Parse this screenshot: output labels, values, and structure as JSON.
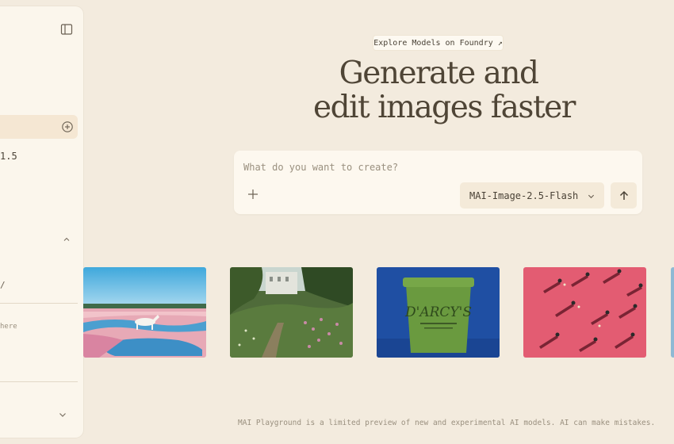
{
  "sidebar": {
    "panel_toggle_icon": "sidebar-panel-icon",
    "new_icon": "plus-circle-icon",
    "version_fragment": "1.5",
    "slash_fragment": "/",
    "here_fragment": "here",
    "collapse_icon": "chevron-up-icon",
    "expand_icon": "chevron-down-icon"
  },
  "hero": {
    "explore_link": "Explore Models on Foundry ↗",
    "headline_line1": "Generate and",
    "headline_line2": "edit images faster"
  },
  "prompt": {
    "placeholder": "What do you want to create?",
    "value": "",
    "attach_icon": "plus-icon",
    "model_selected": "MAI-Image-2.5-Flash",
    "model_icon": "chevron-down-icon",
    "send_icon": "arrow-up-icon"
  },
  "gallery": {
    "items": [
      {
        "description": "white horse in flower lagoon",
        "icon": "image"
      },
      {
        "description": "wildflower garden path",
        "icon": "image"
      },
      {
        "description": "green D'ARCY'S ice cream tub",
        "label": "D'ARCY'S"
      },
      {
        "description": "people on pink ground aerial",
        "icon": "image"
      },
      {
        "description": "partial thumbnail",
        "icon": "image"
      }
    ]
  },
  "footer": {
    "disclaimer": "MAI Playground is a limited preview of new and experimental AI models. AI can make mistakes."
  },
  "colors": {
    "background": "#f3ebde",
    "sidebar": "#fbf6ec",
    "active_item": "#f5e7d3",
    "text": "#4a4236",
    "muted": "#9a907f"
  }
}
